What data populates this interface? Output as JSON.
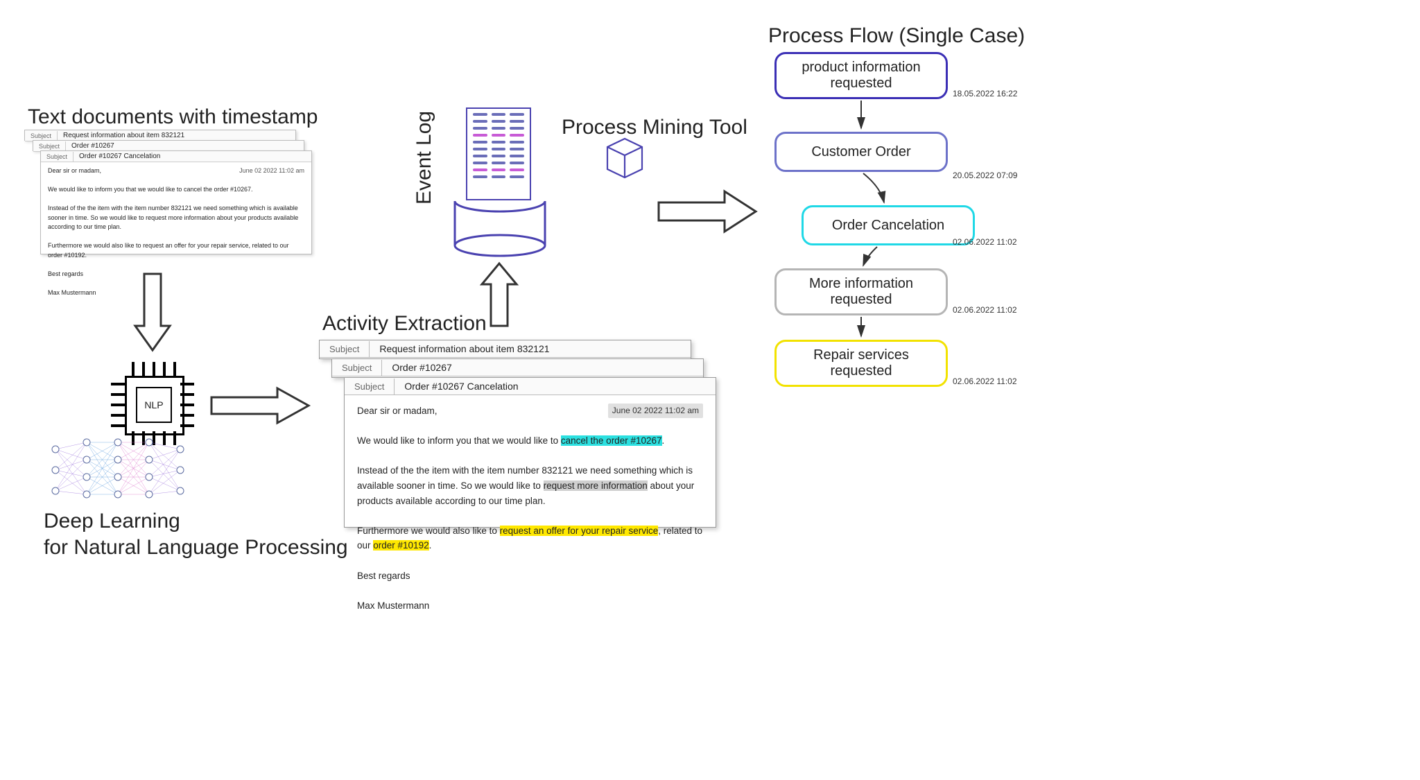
{
  "titles": {
    "documents": "Text documents with timestamp",
    "deeplearning_l1": "Deep Learning",
    "deeplearning_l2": "for Natural Language Processing",
    "activity_extraction": "Activity Extraction",
    "event_log": "Event Log",
    "process_mining": "Process Mining Tool",
    "process_flow": "Process Flow (Single Case)",
    "nlp_chip": "NLP",
    "subject_label": "Subject"
  },
  "emails": {
    "e1_subject": "Request information about item 832121",
    "e2_subject": "Order #10267",
    "e3_subject": "Order #10267 Cancelation",
    "e3_ts": "June 02 2022 11:02 am",
    "e3_greeting": "Dear sir or madam,",
    "e3_p1a": "We would like to inform you that we would like to ",
    "e3_p1_hl": "cancel the order #10267",
    "e3_p1b": ".",
    "e3_p2a": "Instead of the the item with the item number 832121 we need something which is available sooner in time. So we would like to ",
    "e3_p2_hl": "request more information",
    "e3_p2b": " about your products available according to our time plan.",
    "e3_p3a": "Furthermore we would also like to ",
    "e3_p3_hl1": "request an offer for your repair service",
    "e3_p3b": ", related to our ",
    "e3_p3_hl2": "order #10192",
    "e3_p3c": ".",
    "e3_regards": "Best regards",
    "e3_sign": "Max Mustermann"
  },
  "flow": {
    "n1": "product information requested",
    "n1_ts": "18.05.2022 16:22",
    "n2": "Customer Order",
    "n2_ts": "20.05.2022 07:09",
    "n3": "Order Cancelation",
    "n3_ts": "02.06.2022 11:02",
    "n4": "More information requested",
    "n4_ts": "02.06.2022 11:02",
    "n5": "Repair services requested",
    "n5_ts": "02.06.2022 11:02"
  },
  "colors": {
    "n1": "#3b2fb5",
    "n2": "#6d72c9",
    "n3": "#1fd8e6",
    "n4": "#b5b5b5",
    "n5": "#f2e200"
  }
}
